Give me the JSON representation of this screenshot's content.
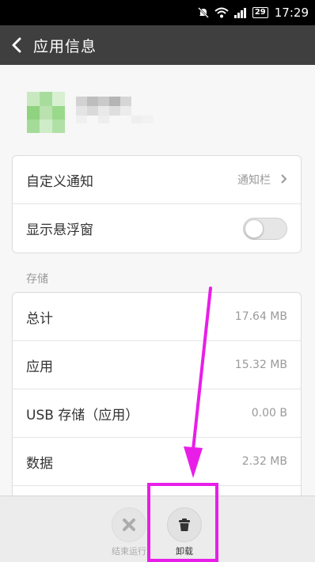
{
  "status_bar": {
    "battery": "29",
    "time": "17:29"
  },
  "header": {
    "title": "应用信息"
  },
  "settings": {
    "notification_label": "自定义通知",
    "notification_value": "通知栏",
    "floating_label": "显示悬浮窗",
    "floating_enabled": false
  },
  "storage": {
    "section_label": "存储",
    "rows": [
      {
        "label": "总计",
        "value": "17.64 MB"
      },
      {
        "label": "应用",
        "value": "15.32 MB"
      },
      {
        "label": "USB 存储（应用）",
        "value": "0.00 B"
      },
      {
        "label": "数据",
        "value": "2.32 MB"
      }
    ]
  },
  "actions": {
    "force_stop": "结束运行",
    "uninstall": "卸载"
  },
  "colors": {
    "header": "#3f3f3f",
    "annotation": "#e81ee8"
  }
}
